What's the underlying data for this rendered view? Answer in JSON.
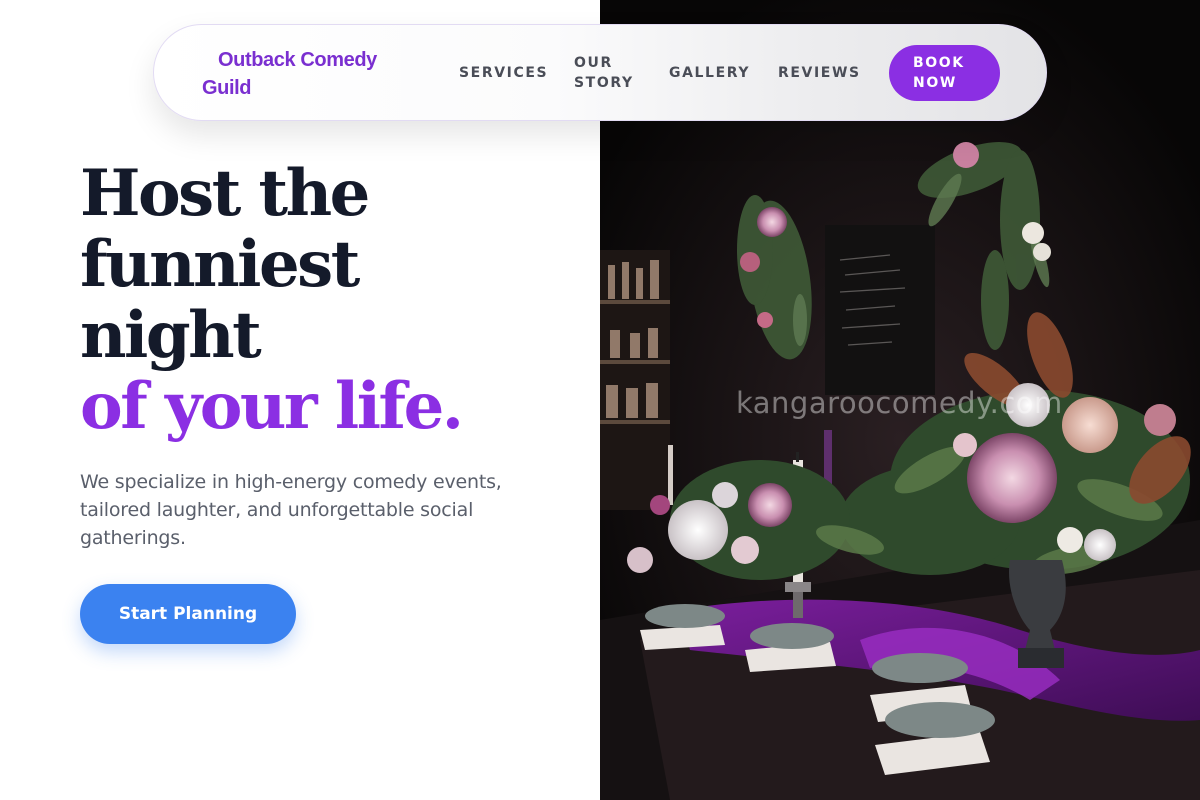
{
  "brand": {
    "name": "Outback Comedy Guild"
  },
  "nav": {
    "links": [
      "SERVICES",
      "OUR STORY",
      "GALLERY",
      "REVIEWS"
    ],
    "cta": "BOOK NOW"
  },
  "hero": {
    "headline_lines": [
      "Host the",
      "funniest",
      "night"
    ],
    "headline_accent": "of your life.",
    "subtext": "We specialize in high-energy comedy events, tailored laughter, and unforgettable social gatherings.",
    "cta": "Start Planning"
  },
  "image": {
    "description_icon": "event-table-flowers-photo",
    "watermark": "kangaroocomedy.com"
  },
  "colors": {
    "brand_purple": "#8b2fe3",
    "cta_blue": "#3b82f0",
    "heading_dark": "#141a2a",
    "body_gray": "#5a5f6b"
  }
}
